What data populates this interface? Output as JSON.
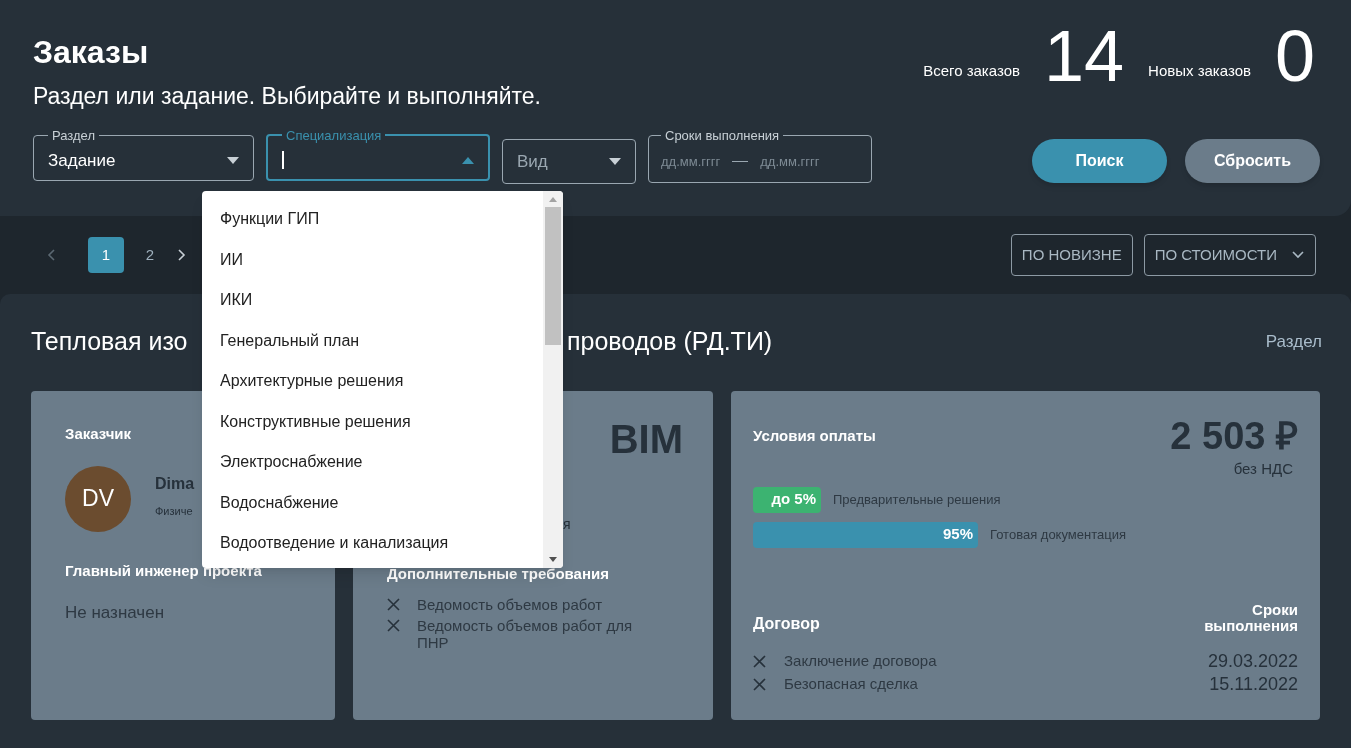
{
  "header": {
    "title": "Заказы",
    "subtitle": "Раздел или задание. Выбирайте и выполняйте.",
    "stats": [
      {
        "label": "Всего заказов",
        "value": "14"
      },
      {
        "label": "Новых заказов",
        "value": "0"
      }
    ]
  },
  "filters": [
    {
      "kind": "select",
      "legend": "Раздел",
      "value": "Задание",
      "open": false
    },
    {
      "kind": "select",
      "legend": "Специализация",
      "open": true
    },
    {
      "kind": "select",
      "placeholder": "Вид",
      "open": false
    },
    {
      "kind": "daterange",
      "legend": "Сроки выполнения",
      "placeholders": [
        "дд.мм.гггг",
        "дд.мм.гггг"
      ]
    }
  ],
  "buttons": [
    {
      "label": "Поиск",
      "kind": "primary"
    },
    {
      "label": "Сбросить",
      "kind": "secondary"
    }
  ],
  "dropdown": {
    "items": [
      "Функции ГИП",
      "ИИ",
      "ИКИ",
      "Генеральный план",
      "Архитектурные решения",
      "Конструктивные решения",
      "Электроснабжение",
      "Водоснабжение",
      "Водоотведение и канализация"
    ]
  },
  "pagination": {
    "pages": [
      {
        "label": "1",
        "selected": true
      },
      {
        "label": "2",
        "selected": false
      }
    ]
  },
  "sort": [
    {
      "label": "ПО НОВИЗНЕ",
      "has_menu": false
    },
    {
      "label": "ПО СТОИМОСТИ",
      "has_menu": true
    }
  ],
  "order": {
    "title_parts": [
      "Тепловая изо",
      "проводов (РД.ТИ)"
    ],
    "section_link": "Раздел",
    "customer": {
      "heading": "Заказчик",
      "initials": "DV",
      "name": "Dima",
      "type": "Физиче",
      "engineer_heading": "Главный инженер проекта",
      "engineer": "Не назначен"
    },
    "details": {
      "badge": "BIM",
      "fragment": "я",
      "extra_heading": "Дополнительные требования",
      "extra": [
        {
          "text": "Ведомость объемов работ",
          "checked": false
        },
        {
          "text": "Ведомость объемов работ для ПНР",
          "checked": false
        }
      ]
    },
    "payment": {
      "heading": "Условия оплаты",
      "price": "2 503 ₽",
      "price_note": "без НДС",
      "stages": [
        {
          "kind": "chip",
          "value": "до 5%",
          "label": "Предварительные решения",
          "color": "#3cb371"
        },
        {
          "kind": "bar",
          "value": "95%",
          "label": "Готовая документация",
          "color": "#3a91ae"
        }
      ],
      "contract_heading": "Договор",
      "deadline_heading": "Сроки выполнения",
      "contract": [
        {
          "text": "Заключение договора",
          "date": "29.03.2022",
          "checked": false
        },
        {
          "text": "Безопасная сделка",
          "date": "15.11.2022",
          "checked": false
        }
      ]
    }
  }
}
